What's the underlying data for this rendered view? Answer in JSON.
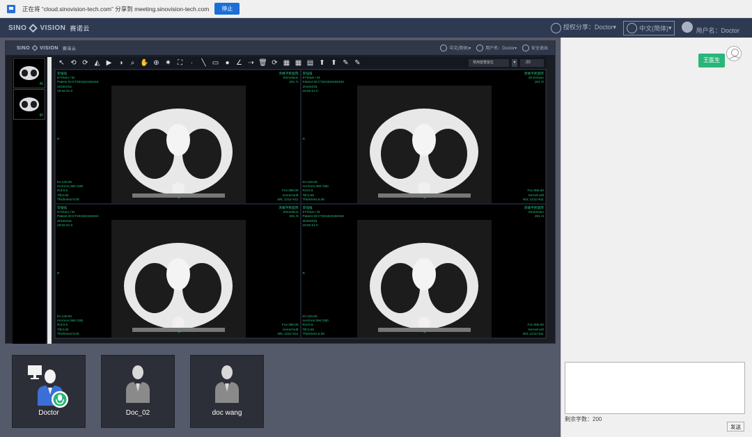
{
  "share_bar": {
    "message": "正在将 “cloud.sinovision-tech.com” 分享到 meeting.sinovision-tech.com",
    "stop_label": "停止"
  },
  "header": {
    "brand_left": "SINO",
    "brand_right": "VISION",
    "brand_cn": "赛诺云",
    "auth_share": "授权分享：Doctor",
    "language": "中文(简体)",
    "username": "用户名：Doctor"
  },
  "inner_header": {
    "brand_left": "SINO",
    "brand_right": "VISION",
    "brand_cn": "赛诺云",
    "language": "中文(简体)",
    "username": "用户名：Doctor",
    "logout": "安全退出"
  },
  "thumbnails": [
    {
      "count": "45"
    },
    {
      "count": "90"
    }
  ],
  "toolbar": {
    "tools": [
      "↖",
      "⟲",
      "⟳",
      "◭",
      "▶",
      "◑",
      "⌕",
      "✋",
      "⊕",
      "✷",
      "⛶",
      "·",
      "╲",
      "▭",
      "●",
      "∠",
      "⇢",
      "🗑",
      "⟳",
      "▦",
      "▦",
      "▤",
      "⬆",
      "⬆",
      "✎",
      "✎"
    ],
    "layout_label": "常用窗宽窗位",
    "count_value": "20"
  },
  "viewports": [
    {
      "top_left": "李强强\n57Years / M\nPatient ID:CT201910150163\n20191015\n15:52:21.0",
      "top_right": "赤峰平民医院\nSinoVision\n201 /1",
      "mid_left": "R",
      "bottom_left": "kV:120.00\nmA/mAs:360 /180\nRot:0.5\nTilt:0.00\nThickness:5.00",
      "bottom_right": "Fov:366.00\nKernel:soft\nW/L:1211/-611",
      "bottom_center": "P"
    },
    {
      "top_left": "李强强\n57Years / M\nPatient ID:CT201910150163\n20191015\n15:52:21.0",
      "top_right": "赤峰平民医院\nSinoVision\n201 /2",
      "mid_left": "R",
      "bottom_left": "kV:120.00\nmA/mAs:360 /180\nRot:0.5\nTilt:0.00\nThickness:5.00",
      "bottom_right": "Fov:366.00\nKernel:soft\nW/L:1211/-611",
      "bottom_center": "P"
    },
    {
      "top_left": "李强强\n57Years / M\nPatient ID:CT201910150163\n20191015\n15:52:21.0",
      "top_right": "赤峰平民医院\nSinoVision\n201 /3",
      "mid_left": "R",
      "bottom_left": "kV:120.00\nmA/mAs:360 /180\nRot:0.5\nTilt:0.00\nThickness:5.00",
      "bottom_right": "Fov:366.00\nKernel:soft\nW/L:1211/-611",
      "bottom_center": "P"
    },
    {
      "top_left": "李强强\n57Years / M\nPatient ID:CT201910150163\n20191015\n15:52:21.0",
      "top_right": "赤峰平民医院\nSinoVision\n201 /4",
      "mid_left": "R",
      "bottom_left": "kV:120.00\nmA/mAs:360 /180\nRot:0.5\nTilt:0.00\nThickness:5.00",
      "bottom_right": "Fov:366.00\nKernel:soft\nW/L:1211/-611",
      "bottom_center": "P"
    }
  ],
  "participants": [
    {
      "name": "Doctor",
      "active": true
    },
    {
      "name": "Doc_02",
      "active": false
    },
    {
      "name": "doc wang",
      "active": false
    }
  ],
  "chat": {
    "sender_label": "王医生",
    "input_value": "",
    "char_count": "剩余字数：200",
    "send_label": "发送"
  },
  "colors": {
    "accent_blue": "#1a6fd8",
    "header_bg": "#2e3a52",
    "overlay_green": "#27c47e",
    "chat_bubble": "#2ab57a"
  }
}
